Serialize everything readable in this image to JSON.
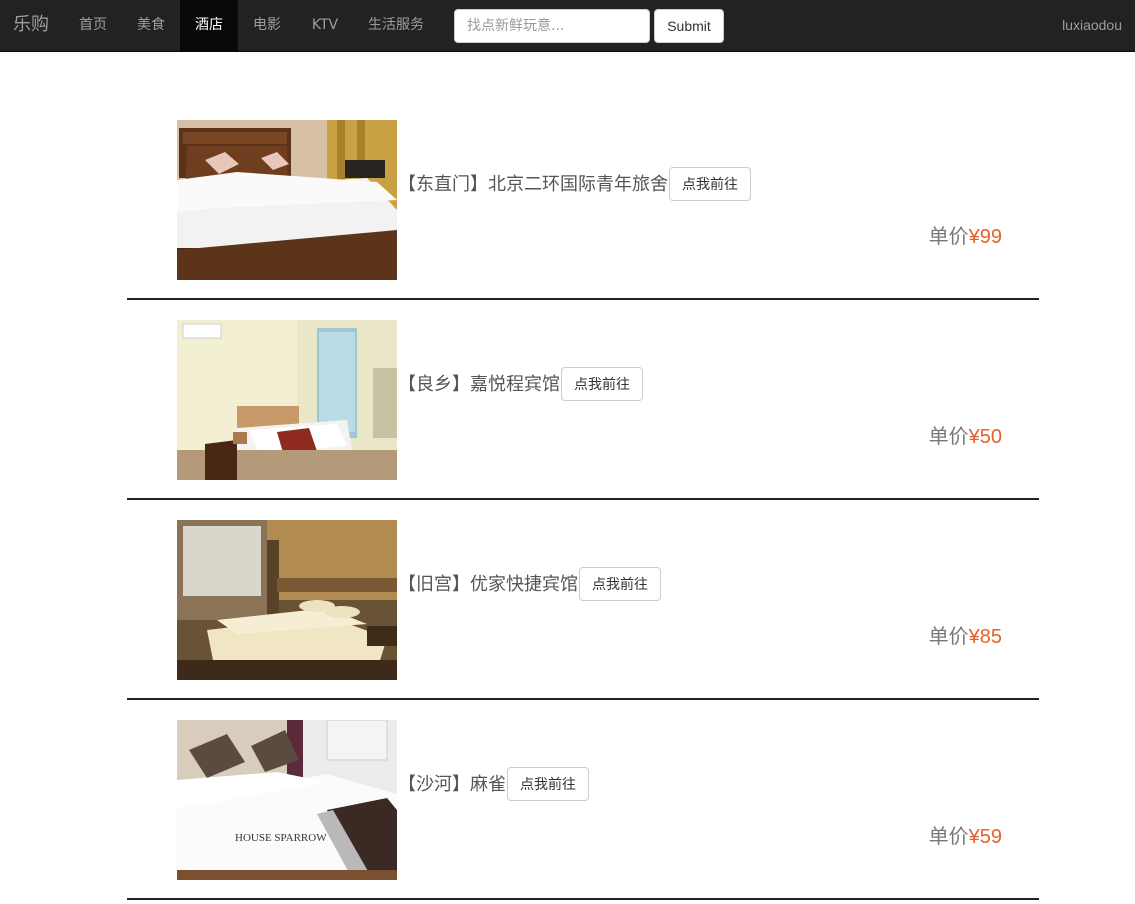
{
  "nav": {
    "brand": "乐购",
    "items": [
      {
        "label": "首页",
        "active": false
      },
      {
        "label": "美食",
        "active": false
      },
      {
        "label": "酒店",
        "active": true
      },
      {
        "label": "电影",
        "active": false
      },
      {
        "label": "KTV",
        "active": false
      },
      {
        "label": "生活服务",
        "active": false
      }
    ],
    "search_placeholder": "找点新鲜玩意...",
    "search_value": "",
    "submit_label": "Submit",
    "username": "luxiaodou"
  },
  "hotels": [
    {
      "name": "【东直门】北京二环国际青年旅舍",
      "button": "点我前往",
      "price_label": "单价",
      "price": "¥99",
      "image": "hotel-room-photo"
    },
    {
      "name": "【良乡】嘉悦程宾馆",
      "button": "点我前往",
      "price_label": "单价",
      "price": "¥50",
      "image": "hotel-room-photo"
    },
    {
      "name": "【旧宫】优家快捷宾馆",
      "button": "点我前往",
      "price_label": "单价",
      "price": "¥85",
      "image": "hotel-room-photo"
    },
    {
      "name": "【沙河】麻雀",
      "button": "点我前往",
      "price_label": "单价",
      "price": "¥59",
      "image": "hotel-room-photo"
    }
  ],
  "image_watermark": "HOUSE SPARROW"
}
